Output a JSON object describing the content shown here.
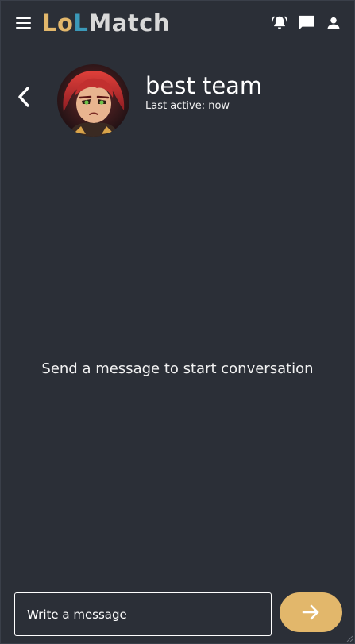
{
  "header": {
    "logo": {
      "part1": "Lo",
      "part2": "L",
      "part3": "M",
      "part4": "atch"
    },
    "icons": [
      "menu-icon",
      "notification-bell-icon",
      "chat-icon",
      "user-icon"
    ]
  },
  "conversation": {
    "title": "best team",
    "status": "Last active: now",
    "avatar_icon": "champion-avatar"
  },
  "main": {
    "empty_text": "Send a message to start conversation"
  },
  "composer": {
    "placeholder": "Write a message",
    "send_icon": "arrow-right-icon"
  },
  "colors": {
    "background": "#2b2f37",
    "accent_gold": "#e2b76b",
    "accent_teal": "#3b99b8",
    "logo_grey": "#d9d9d9"
  }
}
